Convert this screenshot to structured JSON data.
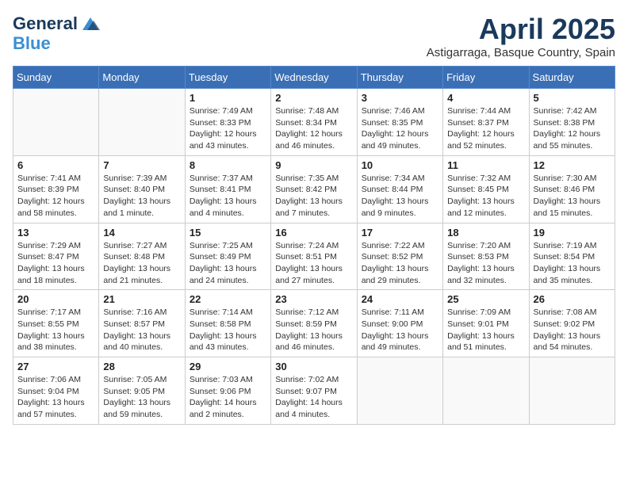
{
  "header": {
    "logo_general": "General",
    "logo_blue": "Blue",
    "title": "April 2025",
    "location": "Astigarraga, Basque Country, Spain"
  },
  "days_of_week": [
    "Sunday",
    "Monday",
    "Tuesday",
    "Wednesday",
    "Thursday",
    "Friday",
    "Saturday"
  ],
  "weeks": [
    [
      {
        "day": "",
        "sunrise": "",
        "sunset": "",
        "daylight": ""
      },
      {
        "day": "",
        "sunrise": "",
        "sunset": "",
        "daylight": ""
      },
      {
        "day": "1",
        "sunrise": "Sunrise: 7:49 AM",
        "sunset": "Sunset: 8:33 PM",
        "daylight": "Daylight: 12 hours and 43 minutes."
      },
      {
        "day": "2",
        "sunrise": "Sunrise: 7:48 AM",
        "sunset": "Sunset: 8:34 PM",
        "daylight": "Daylight: 12 hours and 46 minutes."
      },
      {
        "day": "3",
        "sunrise": "Sunrise: 7:46 AM",
        "sunset": "Sunset: 8:35 PM",
        "daylight": "Daylight: 12 hours and 49 minutes."
      },
      {
        "day": "4",
        "sunrise": "Sunrise: 7:44 AM",
        "sunset": "Sunset: 8:37 PM",
        "daylight": "Daylight: 12 hours and 52 minutes."
      },
      {
        "day": "5",
        "sunrise": "Sunrise: 7:42 AM",
        "sunset": "Sunset: 8:38 PM",
        "daylight": "Daylight: 12 hours and 55 minutes."
      }
    ],
    [
      {
        "day": "6",
        "sunrise": "Sunrise: 7:41 AM",
        "sunset": "Sunset: 8:39 PM",
        "daylight": "Daylight: 12 hours and 58 minutes."
      },
      {
        "day": "7",
        "sunrise": "Sunrise: 7:39 AM",
        "sunset": "Sunset: 8:40 PM",
        "daylight": "Daylight: 13 hours and 1 minute."
      },
      {
        "day": "8",
        "sunrise": "Sunrise: 7:37 AM",
        "sunset": "Sunset: 8:41 PM",
        "daylight": "Daylight: 13 hours and 4 minutes."
      },
      {
        "day": "9",
        "sunrise": "Sunrise: 7:35 AM",
        "sunset": "Sunset: 8:42 PM",
        "daylight": "Daylight: 13 hours and 7 minutes."
      },
      {
        "day": "10",
        "sunrise": "Sunrise: 7:34 AM",
        "sunset": "Sunset: 8:44 PM",
        "daylight": "Daylight: 13 hours and 9 minutes."
      },
      {
        "day": "11",
        "sunrise": "Sunrise: 7:32 AM",
        "sunset": "Sunset: 8:45 PM",
        "daylight": "Daylight: 13 hours and 12 minutes."
      },
      {
        "day": "12",
        "sunrise": "Sunrise: 7:30 AM",
        "sunset": "Sunset: 8:46 PM",
        "daylight": "Daylight: 13 hours and 15 minutes."
      }
    ],
    [
      {
        "day": "13",
        "sunrise": "Sunrise: 7:29 AM",
        "sunset": "Sunset: 8:47 PM",
        "daylight": "Daylight: 13 hours and 18 minutes."
      },
      {
        "day": "14",
        "sunrise": "Sunrise: 7:27 AM",
        "sunset": "Sunset: 8:48 PM",
        "daylight": "Daylight: 13 hours and 21 minutes."
      },
      {
        "day": "15",
        "sunrise": "Sunrise: 7:25 AM",
        "sunset": "Sunset: 8:49 PM",
        "daylight": "Daylight: 13 hours and 24 minutes."
      },
      {
        "day": "16",
        "sunrise": "Sunrise: 7:24 AM",
        "sunset": "Sunset: 8:51 PM",
        "daylight": "Daylight: 13 hours and 27 minutes."
      },
      {
        "day": "17",
        "sunrise": "Sunrise: 7:22 AM",
        "sunset": "Sunset: 8:52 PM",
        "daylight": "Daylight: 13 hours and 29 minutes."
      },
      {
        "day": "18",
        "sunrise": "Sunrise: 7:20 AM",
        "sunset": "Sunset: 8:53 PM",
        "daylight": "Daylight: 13 hours and 32 minutes."
      },
      {
        "day": "19",
        "sunrise": "Sunrise: 7:19 AM",
        "sunset": "Sunset: 8:54 PM",
        "daylight": "Daylight: 13 hours and 35 minutes."
      }
    ],
    [
      {
        "day": "20",
        "sunrise": "Sunrise: 7:17 AM",
        "sunset": "Sunset: 8:55 PM",
        "daylight": "Daylight: 13 hours and 38 minutes."
      },
      {
        "day": "21",
        "sunrise": "Sunrise: 7:16 AM",
        "sunset": "Sunset: 8:57 PM",
        "daylight": "Daylight: 13 hours and 40 minutes."
      },
      {
        "day": "22",
        "sunrise": "Sunrise: 7:14 AM",
        "sunset": "Sunset: 8:58 PM",
        "daylight": "Daylight: 13 hours and 43 minutes."
      },
      {
        "day": "23",
        "sunrise": "Sunrise: 7:12 AM",
        "sunset": "Sunset: 8:59 PM",
        "daylight": "Daylight: 13 hours and 46 minutes."
      },
      {
        "day": "24",
        "sunrise": "Sunrise: 7:11 AM",
        "sunset": "Sunset: 9:00 PM",
        "daylight": "Daylight: 13 hours and 49 minutes."
      },
      {
        "day": "25",
        "sunrise": "Sunrise: 7:09 AM",
        "sunset": "Sunset: 9:01 PM",
        "daylight": "Daylight: 13 hours and 51 minutes."
      },
      {
        "day": "26",
        "sunrise": "Sunrise: 7:08 AM",
        "sunset": "Sunset: 9:02 PM",
        "daylight": "Daylight: 13 hours and 54 minutes."
      }
    ],
    [
      {
        "day": "27",
        "sunrise": "Sunrise: 7:06 AM",
        "sunset": "Sunset: 9:04 PM",
        "daylight": "Daylight: 13 hours and 57 minutes."
      },
      {
        "day": "28",
        "sunrise": "Sunrise: 7:05 AM",
        "sunset": "Sunset: 9:05 PM",
        "daylight": "Daylight: 13 hours and 59 minutes."
      },
      {
        "day": "29",
        "sunrise": "Sunrise: 7:03 AM",
        "sunset": "Sunset: 9:06 PM",
        "daylight": "Daylight: 14 hours and 2 minutes."
      },
      {
        "day": "30",
        "sunrise": "Sunrise: 7:02 AM",
        "sunset": "Sunset: 9:07 PM",
        "daylight": "Daylight: 14 hours and 4 minutes."
      },
      {
        "day": "",
        "sunrise": "",
        "sunset": "",
        "daylight": ""
      },
      {
        "day": "",
        "sunrise": "",
        "sunset": "",
        "daylight": ""
      },
      {
        "day": "",
        "sunrise": "",
        "sunset": "",
        "daylight": ""
      }
    ]
  ]
}
